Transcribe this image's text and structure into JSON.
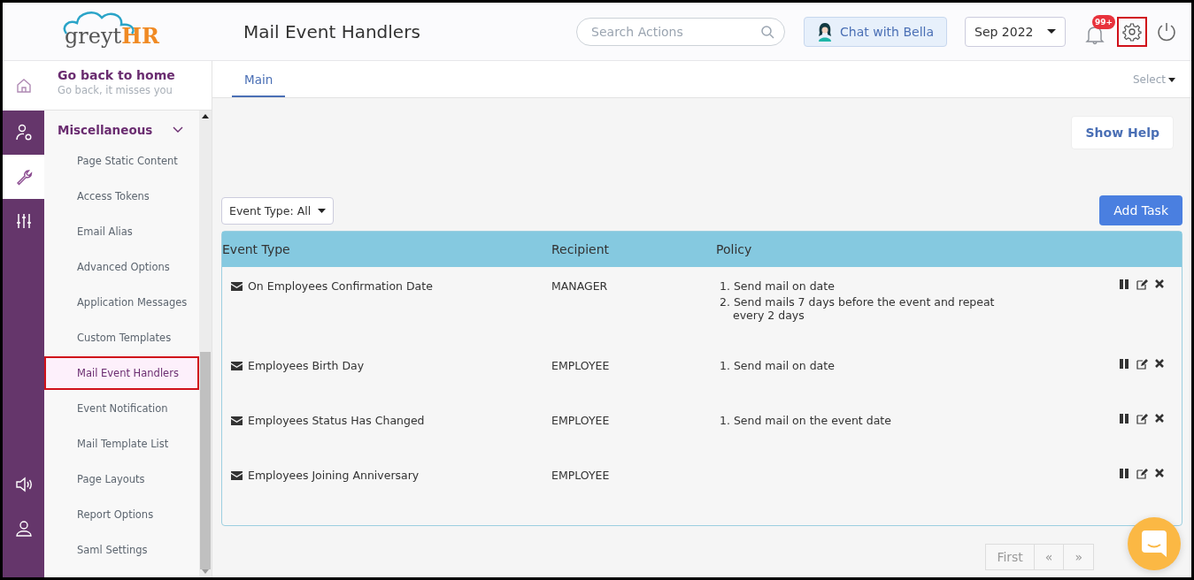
{
  "header": {
    "logo": {
      "text_a": "greyt",
      "text_b": "HR"
    },
    "title": "Mail Event Handlers",
    "search": {
      "placeholder": "Search Actions"
    },
    "chat_button": "Chat with Bella",
    "period": "Sep 2022",
    "notification_badge": "99+",
    "settings_highlighted": true
  },
  "rail": [
    {
      "kind": "home",
      "selected": false
    },
    {
      "kind": "user-settings",
      "selected": false
    },
    {
      "kind": "wrench",
      "selected": true
    },
    {
      "kind": "sliders",
      "selected": false
    },
    {
      "kind": "speaker",
      "selected": false
    },
    {
      "kind": "user",
      "selected": false
    }
  ],
  "home_link": {
    "title": "Go back to home",
    "subtitle": "Go back, it misses you"
  },
  "sidebar": {
    "section": "Miscellaneous",
    "expanded": true,
    "items": [
      {
        "label": "Page Static Content",
        "selected": false
      },
      {
        "label": "Access Tokens",
        "selected": false
      },
      {
        "label": "Email Alias",
        "selected": false
      },
      {
        "label": "Advanced Options",
        "selected": false
      },
      {
        "label": "Application Messages",
        "selected": false
      },
      {
        "label": "Custom Templates",
        "selected": false
      },
      {
        "label": "Mail Event Handlers",
        "selected": true
      },
      {
        "label": "Event Notification",
        "selected": false
      },
      {
        "label": "Mail Template List",
        "selected": false
      },
      {
        "label": "Page Layouts",
        "selected": false
      },
      {
        "label": "Report Options",
        "selected": false
      },
      {
        "label": "Saml Settings",
        "selected": false
      }
    ]
  },
  "tabs": [
    {
      "label": "Main",
      "selected": true
    }
  ],
  "select_menu": "Select",
  "help_button": "Show Help",
  "filter": "Event Type: All",
  "add_button": "Add Task",
  "table": {
    "columns": [
      "Event Type",
      "Recipient",
      "Policy"
    ],
    "rows": [
      {
        "event_type": "On Employees Confirmation Date",
        "recipient": "MANAGER",
        "policy": [
          "1. Send mail on date",
          "2. Send mails 7 days before the event and repeat every 2 days"
        ]
      },
      {
        "event_type": "Employees Birth Day",
        "recipient": "EMPLOYEE",
        "policy": [
          "1. Send mail on date"
        ]
      },
      {
        "event_type": "Employees Status Has Changed",
        "recipient": "EMPLOYEE",
        "policy": [
          "1. Send mail on the event date"
        ]
      },
      {
        "event_type": "Employees Joining Anniversary",
        "recipient": "EMPLOYEE",
        "policy": []
      }
    ]
  },
  "pagination": [
    "First",
    "«",
    "»"
  ]
}
